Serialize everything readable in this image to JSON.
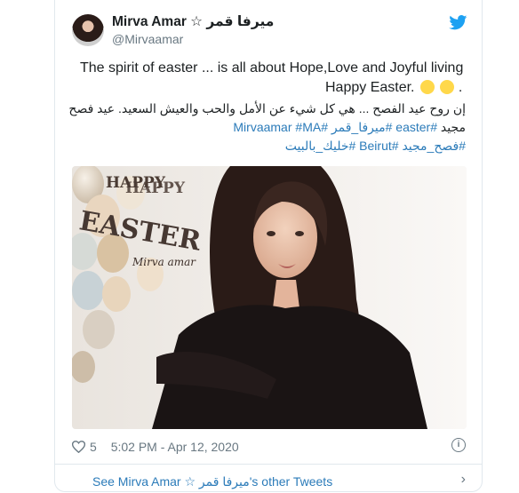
{
  "tweet": {
    "author_name": "Mirva Amar ☆ ميرفا قمر",
    "handle": "@Mirvaamar",
    "line1": "The spirit of easter ... is all about Hope,Love and Joyful living",
    "line2": "Happy Easter.",
    "line2_dot": ".",
    "arabic1_text": "إن روح عيد الفصح ... هي كل شيء عن الأمل والحب والعيش السعيد. عيد فصح",
    "arabic2_plain": "مجيد",
    "arabic2_tag1": "#easter",
    "arabic2_tag2": "#ميرفا_قمر",
    "arabic2_tag3": "#Mirvaamar",
    "arabic2_tag4": "#MA",
    "arabic3_tag1": "#فصح_مجيد",
    "arabic3_tag2": "#Beirut",
    "arabic3_tag3": "#خليك_بالبيت",
    "image_overlay_happy": "HAPPY",
    "image_overlay_easter": "EASTER",
    "image_overlay_signature": "Mirva amar",
    "likes": "5",
    "timestamp": "5:02 PM - Apr 12, 2020",
    "more_tweets": "See Mirva Amar ☆ ميرفا قمر's other Tweets"
  },
  "colors": {
    "link": "#2b7bb9",
    "muted": "#697882",
    "twitter_blue": "#1da1f2"
  },
  "icons": [
    "twitter-bird-icon",
    "heart-icon",
    "info-icon",
    "chevron-right-icon",
    "chick-emoji-icon"
  ]
}
